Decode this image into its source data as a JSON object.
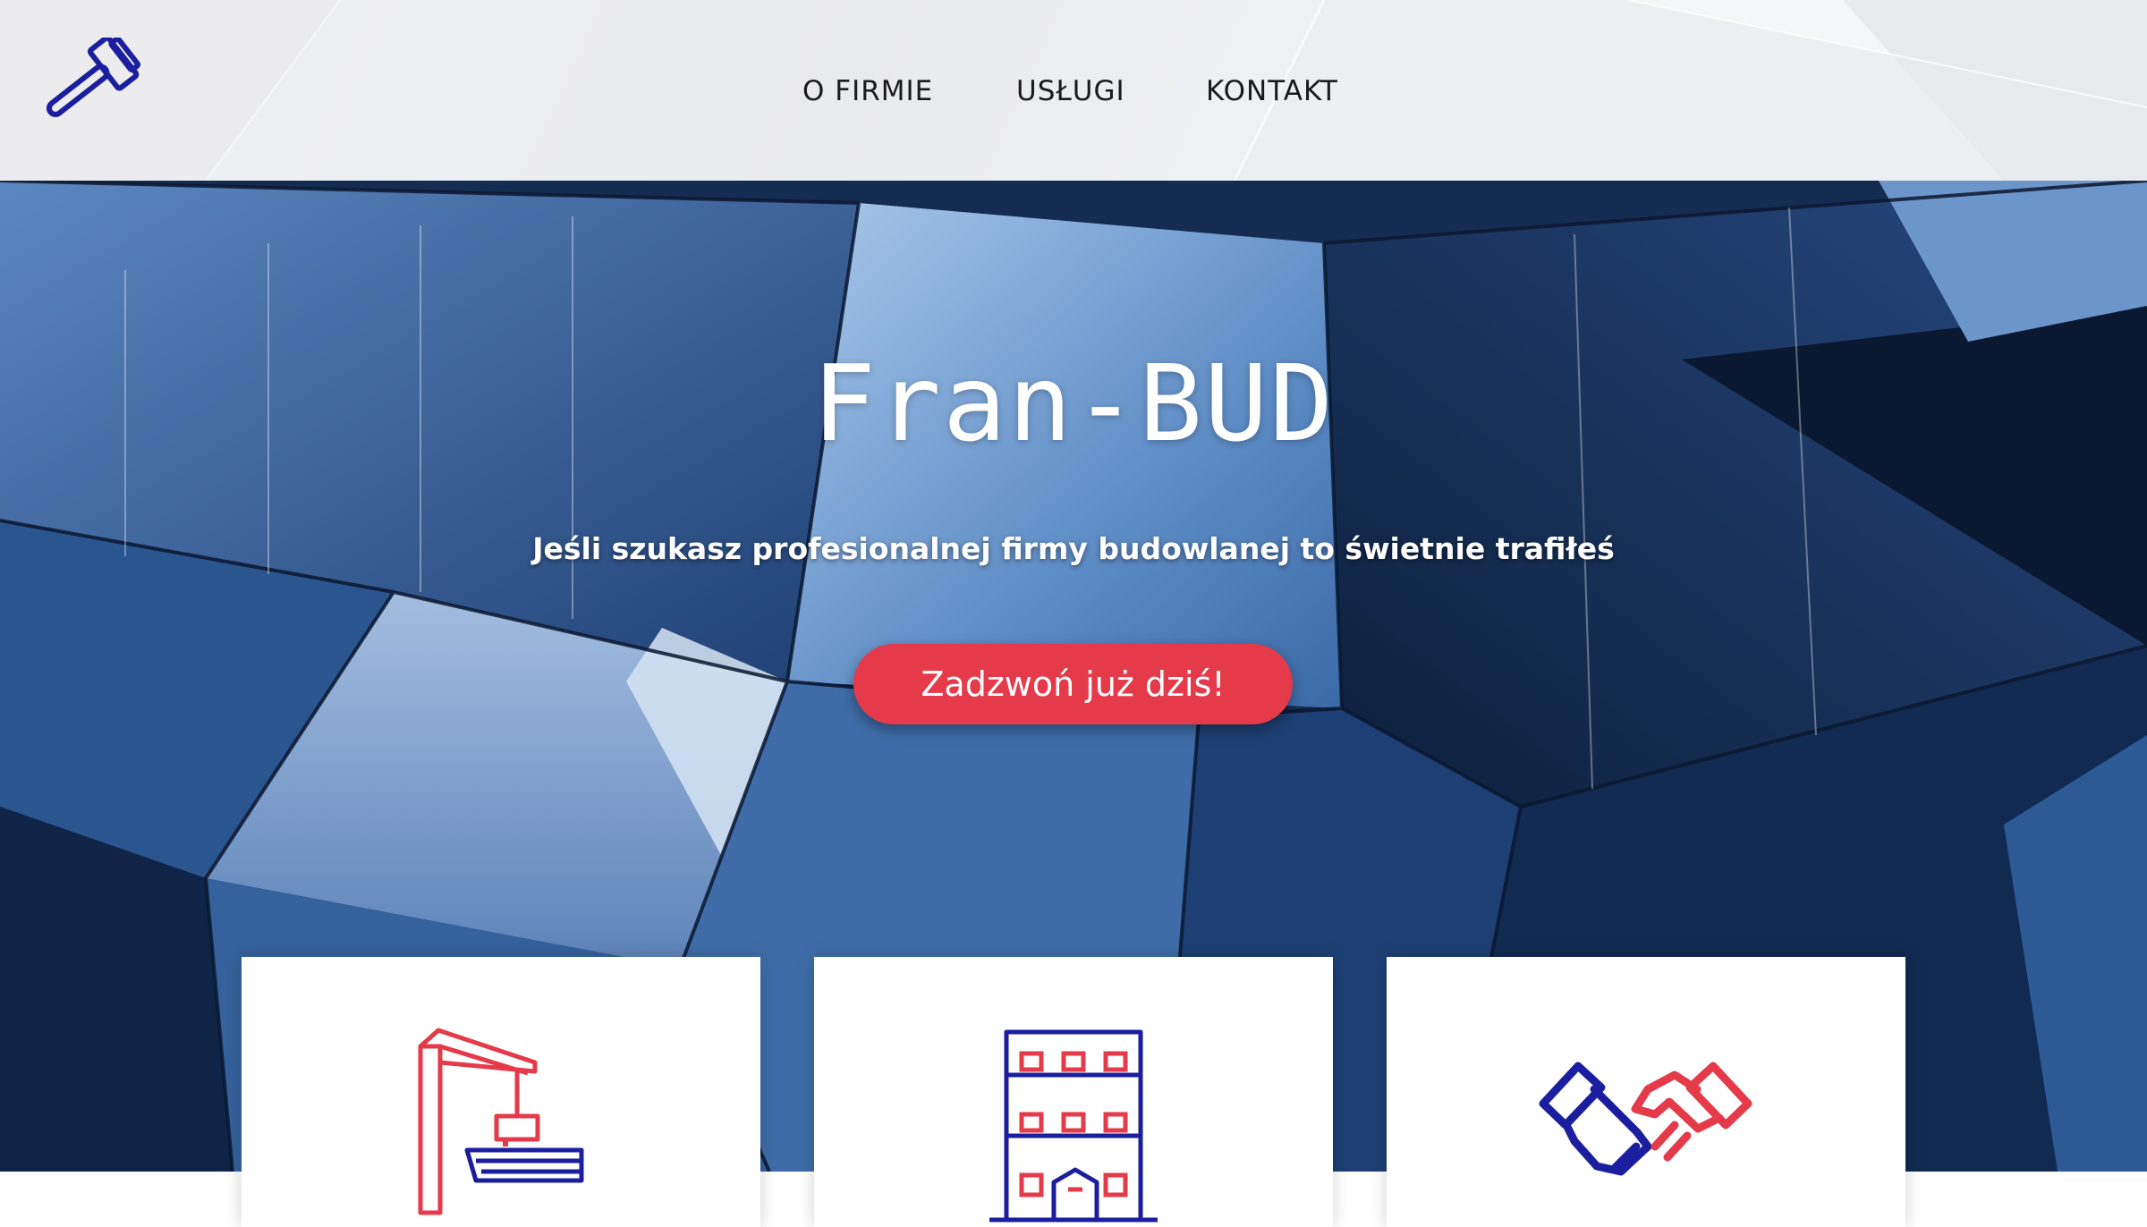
{
  "header": {
    "logo_icon": "hammer-icon",
    "nav": {
      "o_firmie": "O FIRMIE",
      "uslugi": "USŁUGI",
      "kontakt": "KONTAKT"
    }
  },
  "hero": {
    "title": "Fran-BUD",
    "subtitle": "Jeśli szukasz profesionalnej firmy budowlanej to świetnie trafiłeś",
    "cta_label": "Zadzwoń już dziś!"
  },
  "cards": [
    {
      "icon": "crane-icon"
    },
    {
      "icon": "building-icon"
    },
    {
      "icon": "handshake-icon"
    }
  ],
  "colors": {
    "accent_red": "#e43a49",
    "brand_blue": "#1b1e9e",
    "hero_dark": "#13294d"
  }
}
